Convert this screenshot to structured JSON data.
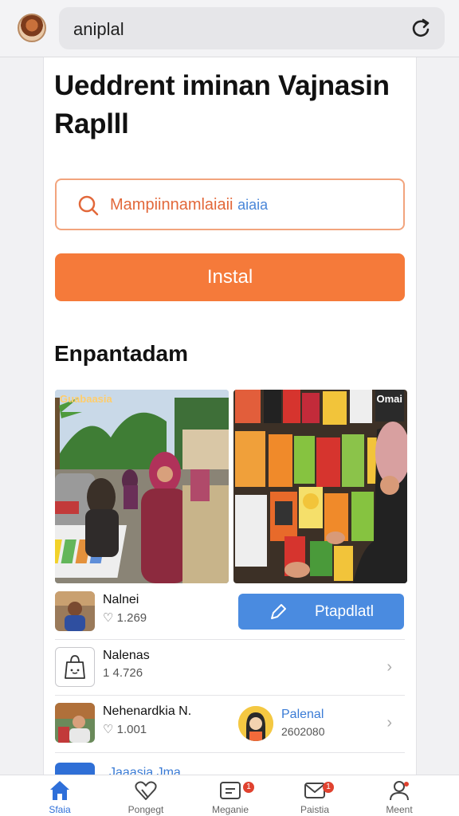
{
  "browser": {
    "url": "aniplal"
  },
  "page": {
    "headline": "Ueddrent iminan Vajnasin Raplll",
    "search_placeholder_main": "Mampiinnamlaiaii",
    "search_placeholder_hint": "aiaia",
    "install_label": "Instal",
    "section_title": "Enpantadam"
  },
  "photos": [
    {
      "tag": "Guabaasia"
    },
    {
      "tag": "Omai"
    }
  ],
  "list": [
    {
      "name": "Nalnei",
      "meta": "♡ 1.269"
    },
    {
      "name": "Nalenas",
      "meta": "1 4.726"
    },
    {
      "name": "Nehenardkia N.",
      "meta": "♡ 1.001"
    },
    {
      "name": "Jaaasia Jma"
    }
  ],
  "update_button": {
    "label": "Ptapdlatl"
  },
  "profile": {
    "name": "Palenal",
    "meta": "2602080"
  },
  "bottom_nav": [
    {
      "label": "Sfaia",
      "icon": "home-icon",
      "active": true
    },
    {
      "label": "Pongegt",
      "icon": "heart-icon"
    },
    {
      "label": "Meganie",
      "icon": "message-icon",
      "badge": "1"
    },
    {
      "label": "Paistia",
      "icon": "mail-icon",
      "badge": "1"
    },
    {
      "label": "Meent",
      "icon": "profile-icon"
    }
  ],
  "colors": {
    "accent_orange": "#f57a3a",
    "accent_blue": "#4a8be0",
    "badge_red": "#e0422f"
  }
}
